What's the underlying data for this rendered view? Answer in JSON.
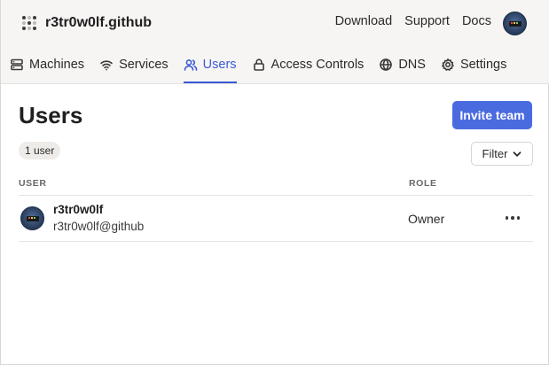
{
  "brand": {
    "title": "r3tr0w0lf.github",
    "icon": "grid-dots-icon"
  },
  "top_links": {
    "download": "Download",
    "support": "Support",
    "docs": "Docs"
  },
  "tabs": [
    {
      "label": "Machines",
      "icon": "server-icon",
      "active": false
    },
    {
      "label": "Services",
      "icon": "wifi-icon",
      "active": false
    },
    {
      "label": "Users",
      "icon": "users-icon",
      "active": true
    },
    {
      "label": "Access Controls",
      "icon": "lock-icon",
      "active": false
    },
    {
      "label": "DNS",
      "icon": "globe-icon",
      "active": false
    },
    {
      "label": "Settings",
      "icon": "gear-icon",
      "active": false
    }
  ],
  "page": {
    "title": "Users",
    "invite_label": "Invite team",
    "count_label": "1 user",
    "filter_label": "Filter"
  },
  "table": {
    "headers": {
      "user": "USER",
      "role": "ROLE"
    },
    "rows": [
      {
        "name": "r3tr0w0lf",
        "email": "r3tr0w0lf@github",
        "role": "Owner"
      }
    ]
  },
  "colors": {
    "accent": "#4a6be0",
    "active_tab": "#3b5bd6",
    "header_bg": "#f7f5f4"
  }
}
